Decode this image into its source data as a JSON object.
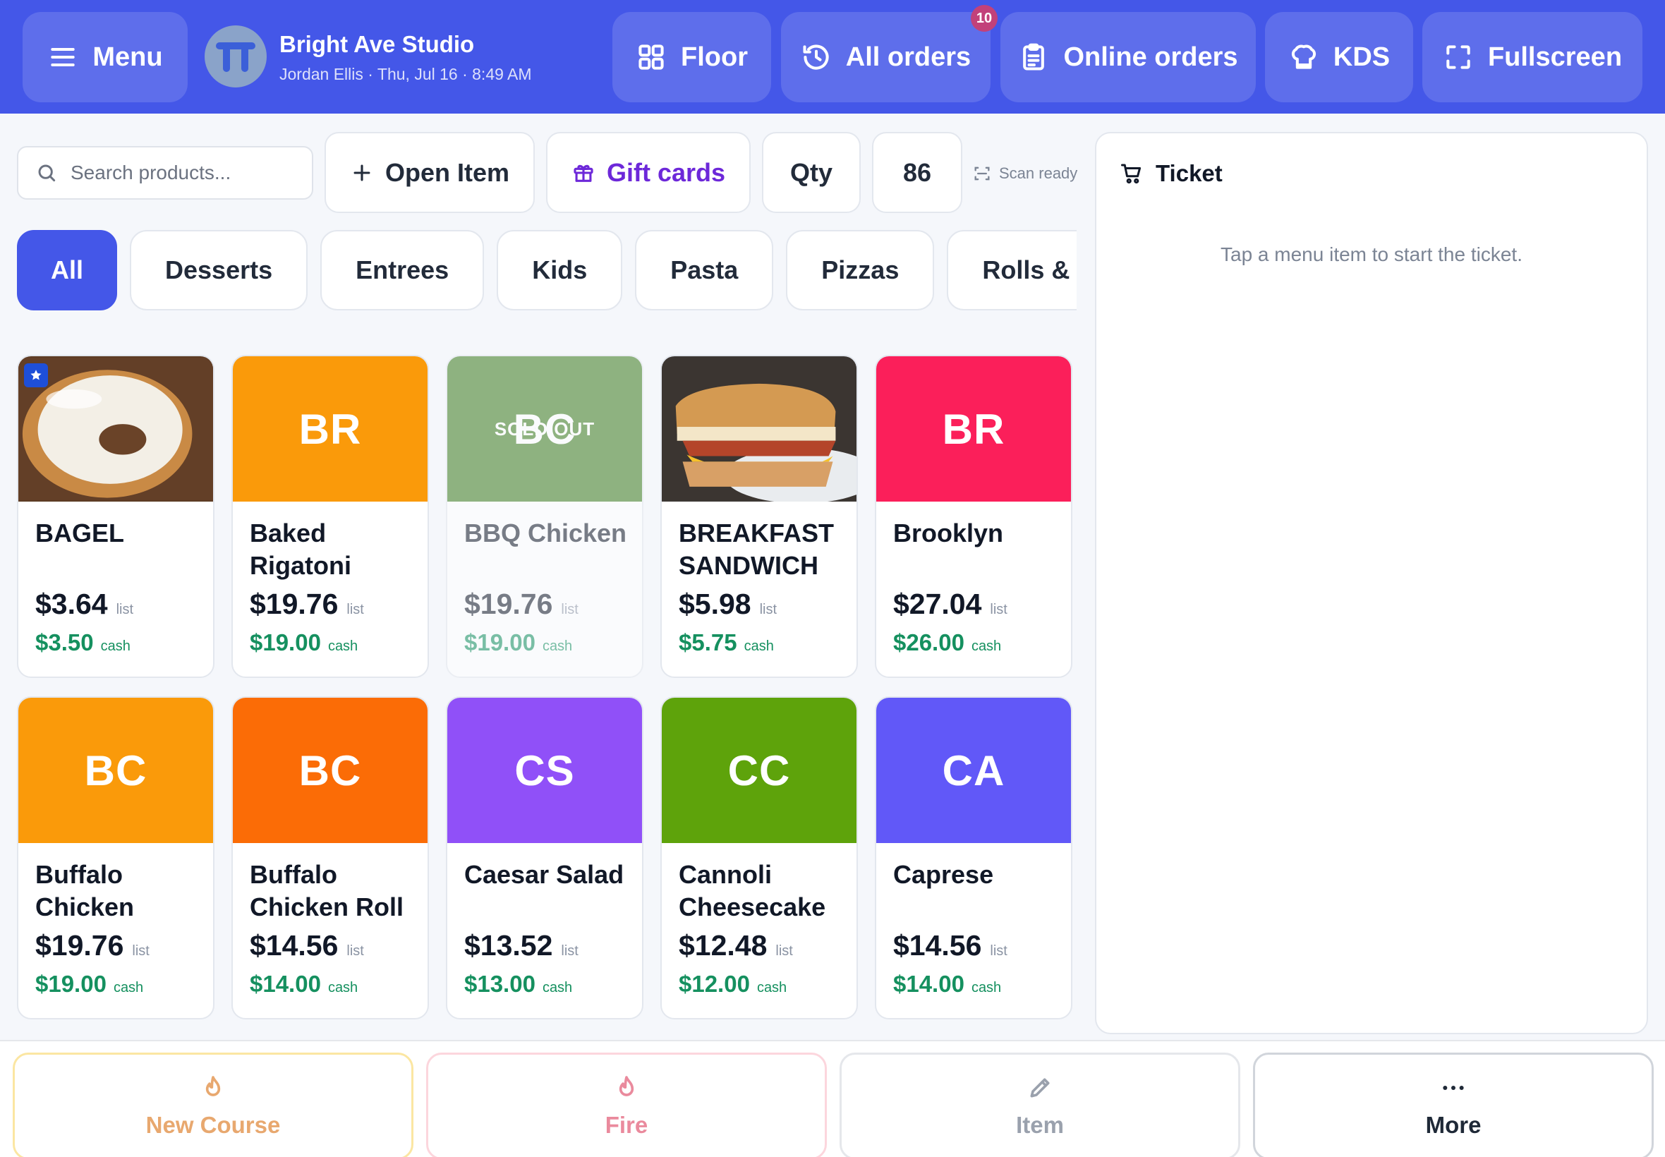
{
  "header": {
    "menu_label": "Menu",
    "store_name": "Bright Ave Studio",
    "store_subtitle": "Jordan Ellis · Thu, Jul 16 · 8:49 AM",
    "nav": [
      {
        "label": "Floor",
        "icon": "grid-icon"
      },
      {
        "label": "All orders",
        "icon": "history-icon",
        "badge": "10"
      },
      {
        "label": "Online orders",
        "icon": "clipboard-icon"
      },
      {
        "label": "KDS",
        "icon": "chef-hat-icon"
      },
      {
        "label": "Fullscreen",
        "icon": "fullscreen-icon"
      }
    ]
  },
  "toolbar": {
    "search_placeholder": "Search products...",
    "open_item_label": "Open Item",
    "gift_cards_label": "Gift cards",
    "qty_label": "Qty",
    "eightysix_label": "86",
    "scan_status": "Scan ready"
  },
  "categories": [
    {
      "label": "All",
      "active": true
    },
    {
      "label": "Desserts"
    },
    {
      "label": "Entrees"
    },
    {
      "label": "Kids"
    },
    {
      "label": "Pasta"
    },
    {
      "label": "Pizzas"
    },
    {
      "label": "Rolls & Ca"
    }
  ],
  "price_tags": {
    "list": "list",
    "cash": "cash"
  },
  "products": [
    {
      "name": "BAGEL",
      "image": "bagel-photo",
      "favorite": true,
      "list_price": "$3.64",
      "cash_price": "$3.50"
    },
    {
      "name": "Baked Rigatoni",
      "initials": "BR",
      "color": "#fa9a0a",
      "list_price": "$19.76",
      "cash_price": "$19.00"
    },
    {
      "name": "BBQ Chicken",
      "initials": "BC",
      "color": "#3a7a1c",
      "sold_out": true,
      "sold_out_label": "SOLD OUT",
      "list_price": "$19.76",
      "cash_price": "$19.00"
    },
    {
      "name": "BREAKFAST SANDWICH",
      "image": "sandwich-photo",
      "list_price": "$5.98",
      "cash_price": "$5.75"
    },
    {
      "name": "Brooklyn",
      "initials": "BR",
      "color": "#fb1f5a",
      "list_price": "$27.04",
      "cash_price": "$26.00"
    },
    {
      "name": "Buffalo Chicken",
      "initials": "BC",
      "color": "#fa9a0a",
      "list_price": "$19.76",
      "cash_price": "$19.00"
    },
    {
      "name": "Buffalo Chicken Roll",
      "initials": "BC",
      "color": "#fb6c06",
      "list_price": "$14.56",
      "cash_price": "$14.00"
    },
    {
      "name": "Caesar Salad",
      "initials": "CS",
      "color": "#9050f8",
      "list_price": "$13.52",
      "cash_price": "$13.00"
    },
    {
      "name": "Cannoli Cheesecake",
      "initials": "CC",
      "color": "#5ea30b",
      "list_price": "$12.48",
      "cash_price": "$12.00"
    },
    {
      "name": "Caprese",
      "initials": "CA",
      "color": "#6158f8",
      "list_price": "$14.56",
      "cash_price": "$14.00"
    }
  ],
  "ticket": {
    "title": "Ticket",
    "empty_message": "Tap a menu item to start the ticket."
  },
  "bottom_bar": [
    {
      "label": "New Course",
      "icon": "flame-icon",
      "color": "#e8a86f",
      "border": "#fbe6a2"
    },
    {
      "label": "Fire",
      "icon": "flame-icon",
      "color": "#ea8a9d",
      "border": "#fcd6dd"
    },
    {
      "label": "Item",
      "icon": "pencil-icon",
      "color": "#9aa1ad",
      "border": "#e5e7eb"
    },
    {
      "label": "More",
      "icon": "more-icon",
      "color": "#1f2937",
      "border": "#d1d5db"
    }
  ],
  "colors": {
    "brand": "#4457e8",
    "accent_gift": "#6d28d9",
    "cash_green": "#15905f",
    "badge": "#c2417a"
  }
}
